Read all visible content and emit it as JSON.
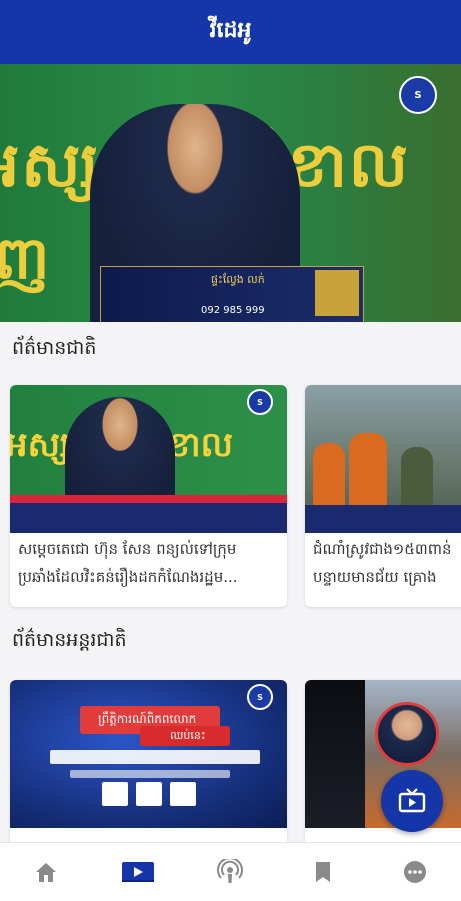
{
  "header": {
    "title": "វីដេអូ"
  },
  "hero": {
    "slogan_top": "អស្សយុជ ឆ្នាំខាល",
    "slogan_bottom": "ញ",
    "banner_text": "ផ្ទះល្វែង លក់",
    "banner_phone": "092 985 999",
    "logo_text": "SBM News"
  },
  "sections": [
    {
      "title": "ព័ត៌មានជាតិ",
      "cards": [
        {
          "caption_line1": "សម្ដេចតេជោ ហ៊ុន សែន ពន្យល់ទៅក្រុម",
          "caption_line2": "ប្រឆាំងដែលវិះគន់រឿងដកកំណែងរដ្ឋម..."
        },
        {
          "caption_line1": "ជំណាំស្រូវជាង១៥៣ពាន់",
          "caption_line2": "បន្ទាយមានជ័យ គ្រោង"
        }
      ]
    },
    {
      "title": "ព័ត៌មានអន្តរជាតិ",
      "cards": [
        {
          "caption_line1": "ព្រឹត្តិការណ៍ពិភពលោក",
          "caption_line2": "ឈប់នេះ"
        },
        {
          "caption_line1": "",
          "caption_line2": ""
        }
      ]
    }
  ],
  "fab": {
    "icon": "tv-icon"
  },
  "nav": [
    {
      "icon": "home-icon",
      "active": false
    },
    {
      "icon": "video-icon",
      "active": true
    },
    {
      "icon": "podcast-icon",
      "active": false
    },
    {
      "icon": "bookmark-icon",
      "active": false
    },
    {
      "icon": "more-icon",
      "active": false
    }
  ],
  "colors": {
    "primary": "#1536a8",
    "nav_inactive": "#8a8a8a"
  }
}
